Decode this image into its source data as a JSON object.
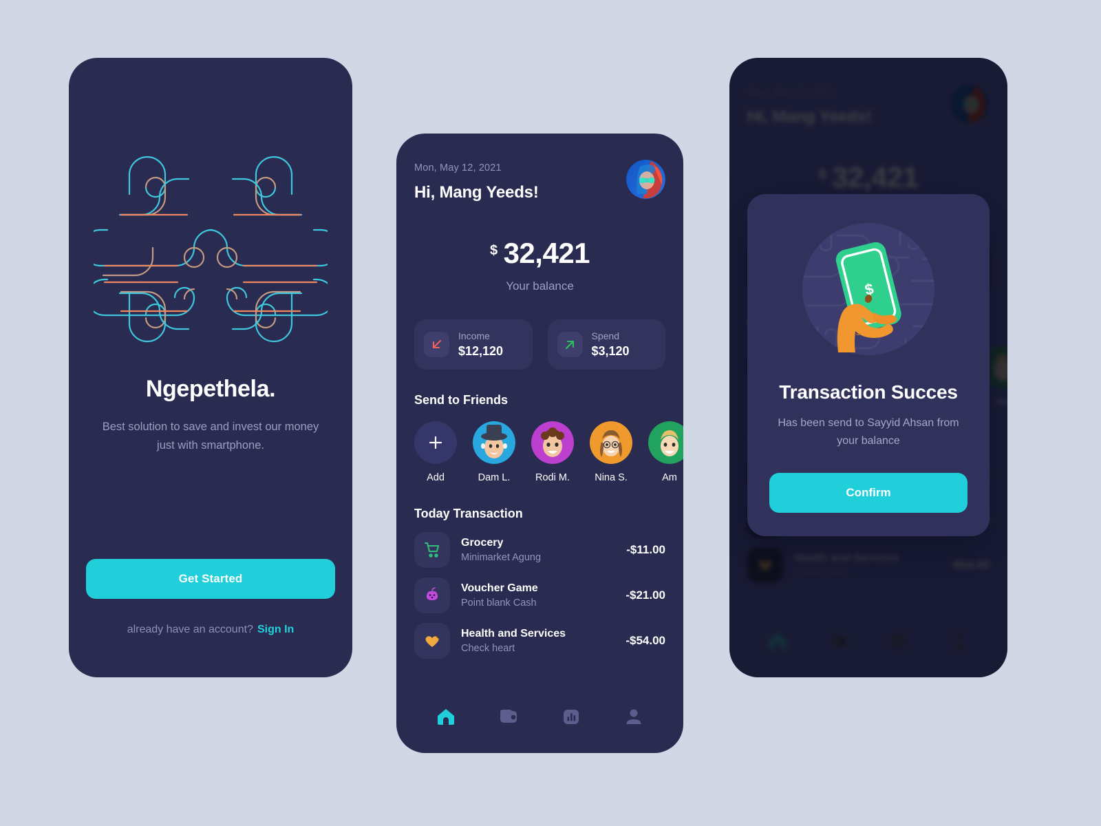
{
  "theme": {
    "page_bg": "#d2d7e6",
    "phone_bg": "#2a2b50",
    "card_bg": "#33345d",
    "accent": "#20cfd9",
    "text_primary": "#ffffff",
    "text_muted": "#9196bd",
    "income_arrow": "#f2615c",
    "spend_arrow": "#2fbf5e"
  },
  "onboarding": {
    "art_name": "ornamental-knot-illustration",
    "title": "Ngepethela.",
    "subtitle": "Best solution to save and invest our money just with smartphone.",
    "cta_label": "Get Started",
    "signin_prompt": "already have an account?",
    "signin_label": "Sign In"
  },
  "dashboard": {
    "date": "Mon, May 12, 2021",
    "greeting": "Hi, Mang Yeeds!",
    "avatar_name": "user-avatar",
    "balance": {
      "currency": "$",
      "amount": "32,421",
      "label": "Your balance"
    },
    "stats": [
      {
        "label": "Income",
        "value": "$12,120",
        "icon": "arrow-down-left-icon",
        "color": "#f2615c"
      },
      {
        "label": "Spend",
        "value": "$3,120",
        "icon": "arrow-up-right-icon",
        "color": "#2fbf5e"
      }
    ],
    "friends_section_title": "Send to Friends",
    "friends": [
      {
        "name": "Add",
        "type": "add",
        "bg": "#35366a",
        "emoji": ""
      },
      {
        "name": "Dam L.",
        "type": "avatar",
        "bg": "#29a8e0",
        "emoji": "🎩"
      },
      {
        "name": "Rodi M.",
        "type": "avatar",
        "bg": "#bd3fd0",
        "emoji": "😃"
      },
      {
        "name": "Nina S.",
        "type": "avatar",
        "bg": "#f09a2e",
        "emoji": "👧"
      },
      {
        "name": "Am",
        "type": "avatar",
        "bg": "#21a35f",
        "emoji": "👱"
      }
    ],
    "transactions_section_title": "Today Transaction",
    "transactions": [
      {
        "title": "Grocery",
        "subtitle": "Minimarket Agung",
        "amount": "-$11.00",
        "icon": "shopping-cart-icon",
        "color": "#2fbf7a"
      },
      {
        "title": "Voucher Game",
        "subtitle": "Point blank Cash",
        "amount": "-$21.00",
        "icon": "game-voucher-icon",
        "color": "#c04adb"
      },
      {
        "title": "Health and Services",
        "subtitle": "Check heart",
        "amount": "-$54.00",
        "icon": "heart-icon",
        "color": "#f0a93e"
      }
    ],
    "tabs": [
      {
        "name": "home",
        "icon": "home-icon",
        "active": true
      },
      {
        "name": "wallet",
        "icon": "wallet-icon",
        "active": false
      },
      {
        "name": "stats",
        "icon": "bar-chart-icon",
        "active": false
      },
      {
        "name": "profile",
        "icon": "person-icon",
        "active": false
      }
    ]
  },
  "success_modal": {
    "art_name": "hand-holding-phone-illustration",
    "title": "Transaction Succes",
    "message": "Has been send to Sayyid Ahsan from your balance",
    "confirm_label": "Confirm"
  }
}
